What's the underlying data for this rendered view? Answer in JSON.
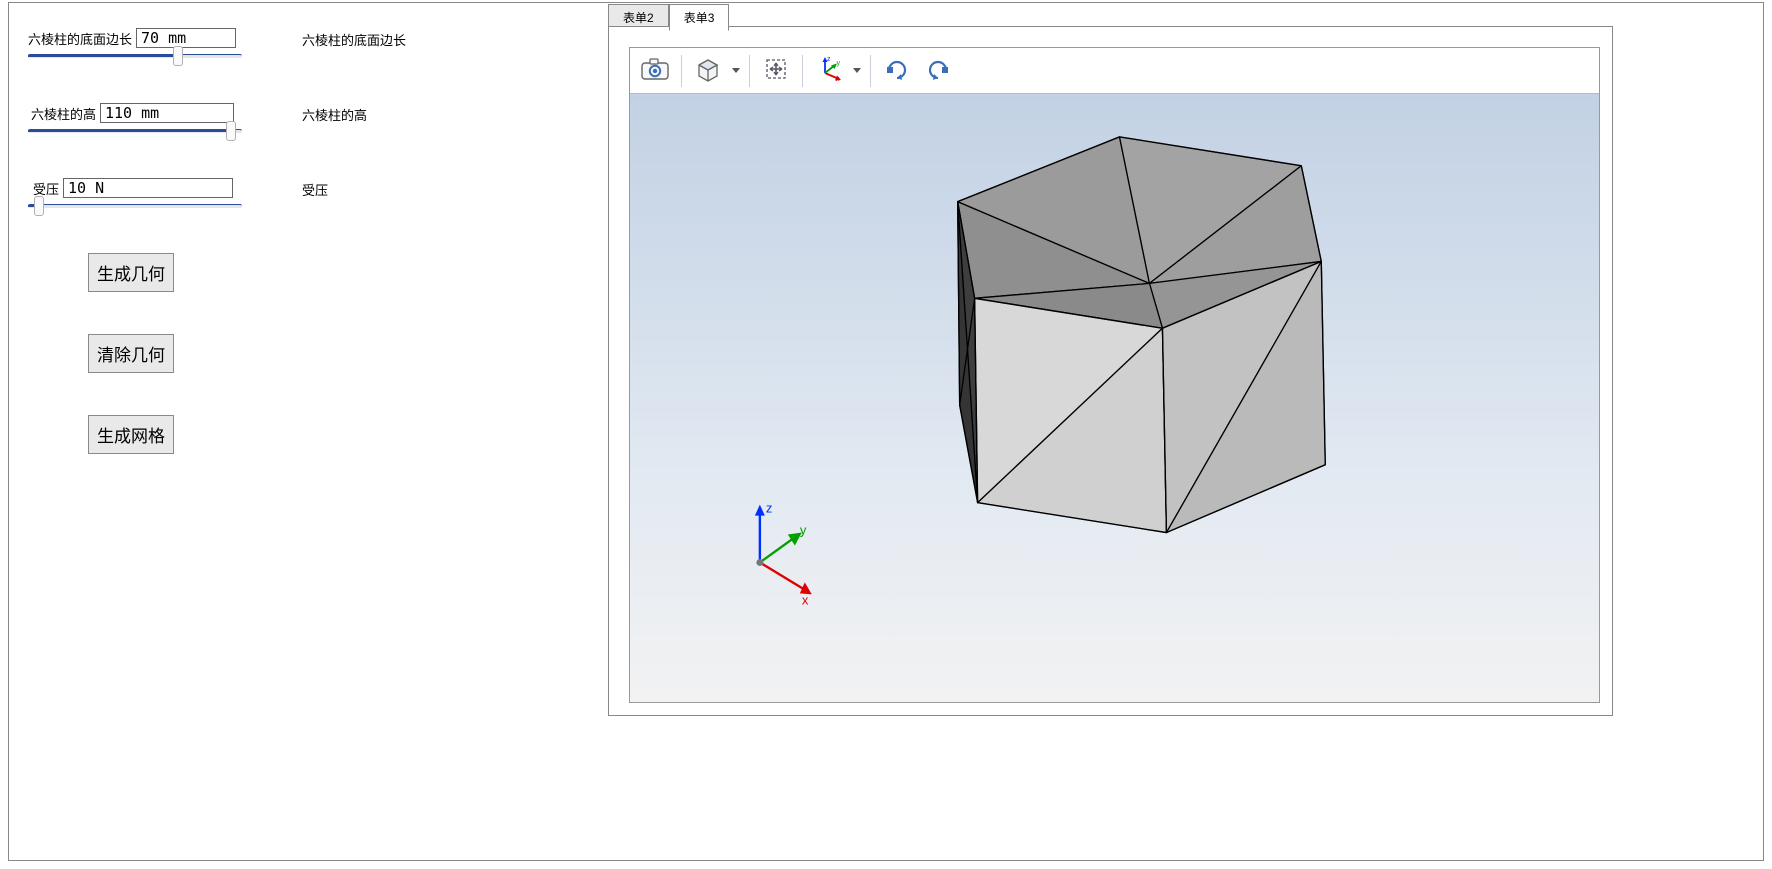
{
  "tabs": {
    "items": [
      {
        "label": "表单2"
      },
      {
        "label": "表单3"
      }
    ],
    "active_index": 1
  },
  "left": {
    "fields": {
      "edge": {
        "label": "六棱柱的底面边长",
        "value": "70 mm",
        "side_label": "六棱柱的底面边长",
        "slider_pct": 70
      },
      "height": {
        "label": "六棱柱的高",
        "value": "110 mm",
        "side_label": "六棱柱的高",
        "slider_pct": 95
      },
      "pressure": {
        "label": "受压",
        "value": "10 N",
        "side_label": "受压",
        "slider_pct": 5
      }
    },
    "buttons": {
      "gen_geom": "生成几何",
      "clear_geom": "清除几何",
      "gen_mesh": "生成网格"
    }
  },
  "toolbar": {
    "icons": {
      "snapshot": "snapshot-icon",
      "cube": "cube-icon",
      "zoom_extents": "zoom-extents-icon",
      "axis": "axis-icon",
      "rotate_cw": "rotate-cw-icon",
      "rotate_ccw": "rotate-ccw-icon"
    }
  },
  "axes_labels": {
    "x": "x",
    "y": "y",
    "z": "z"
  }
}
